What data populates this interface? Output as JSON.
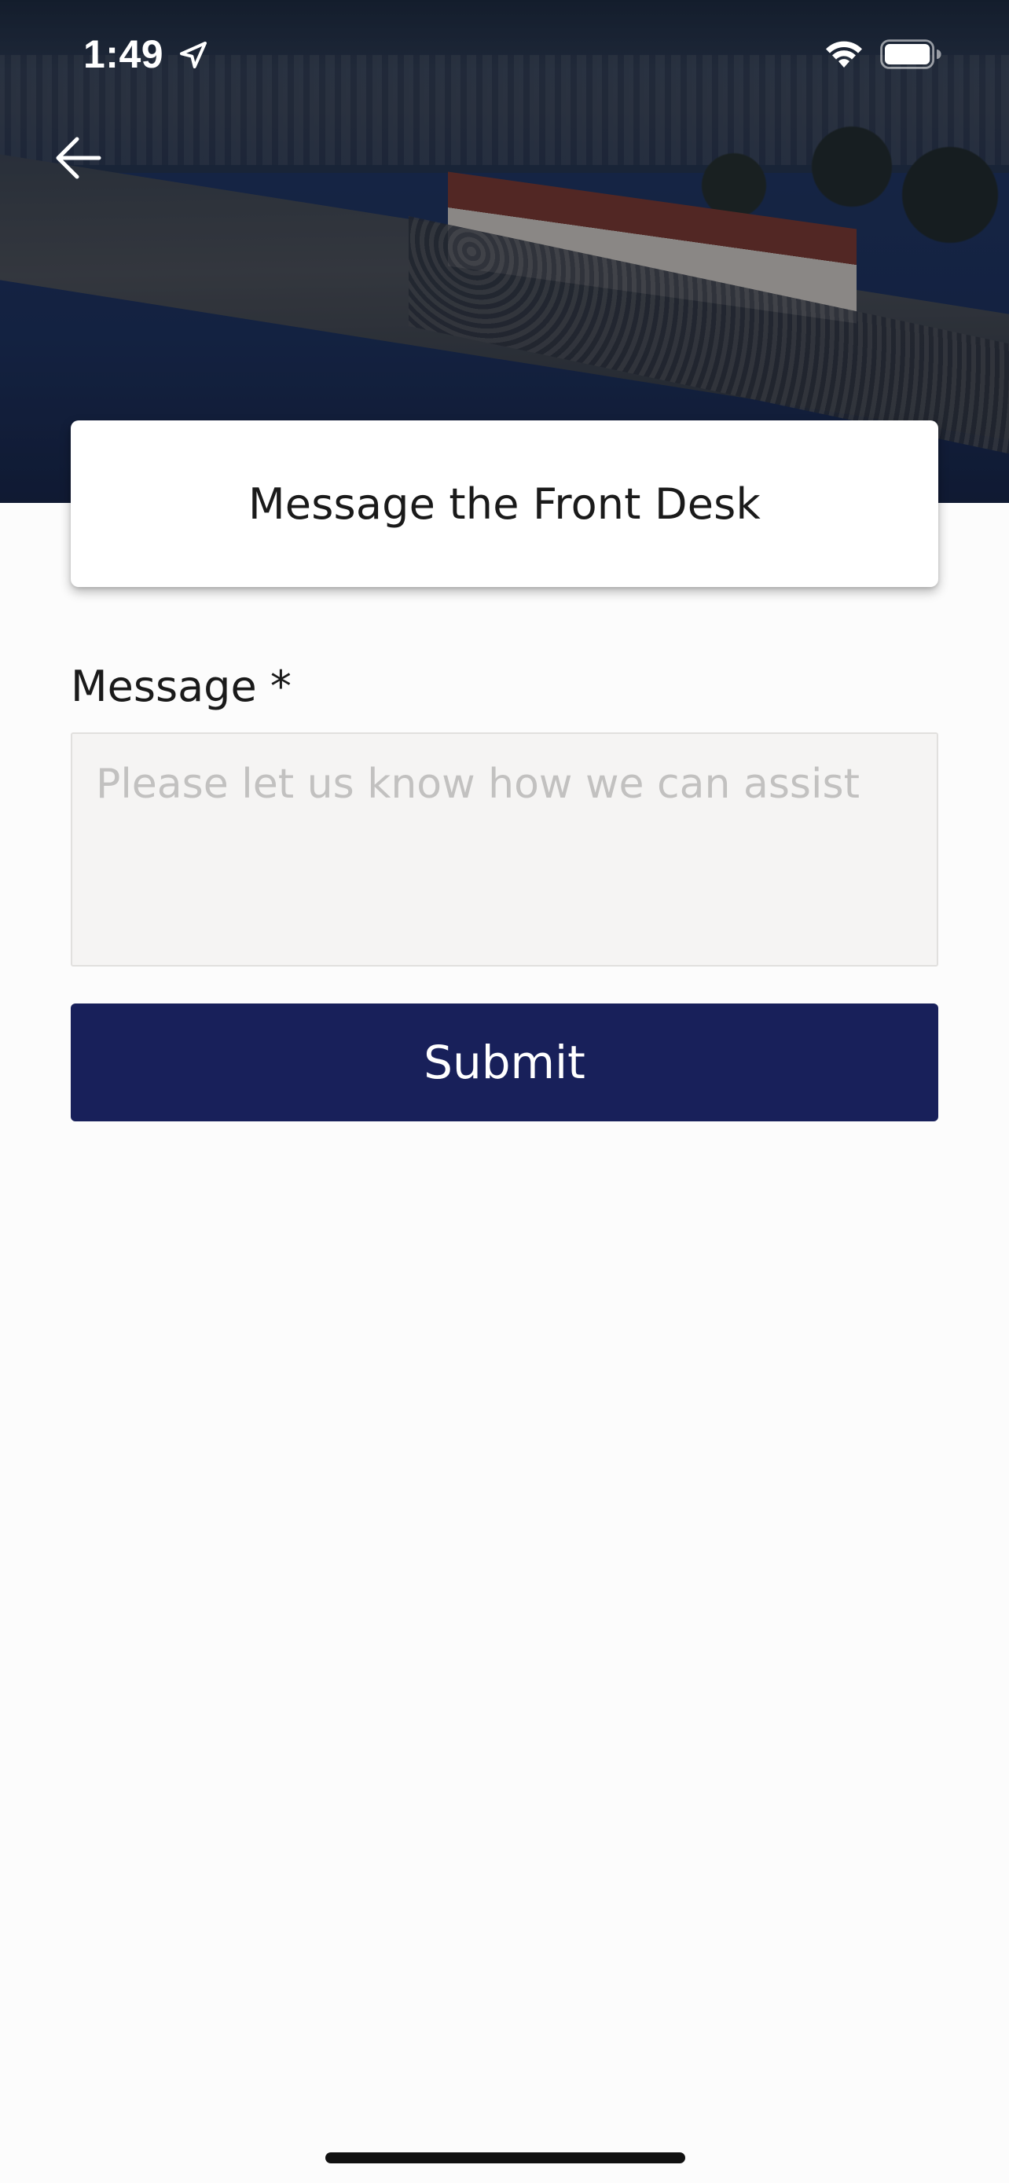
{
  "status_bar": {
    "time": "1:49",
    "location_icon": "location-arrow-icon",
    "wifi_icon": "wifi-icon",
    "battery_icon": "battery-icon"
  },
  "header": {
    "back_icon": "arrow-left-icon",
    "title": "Message the Front Desk"
  },
  "form": {
    "message_label": "Message *",
    "message_value": "",
    "message_placeholder": "Please let us know how we can assist",
    "submit_label": "Submit"
  },
  "colors": {
    "accent": "#18205a",
    "background": "#fcfcfc",
    "input_background": "#f5f4f3",
    "placeholder": "#c2c1c0"
  }
}
